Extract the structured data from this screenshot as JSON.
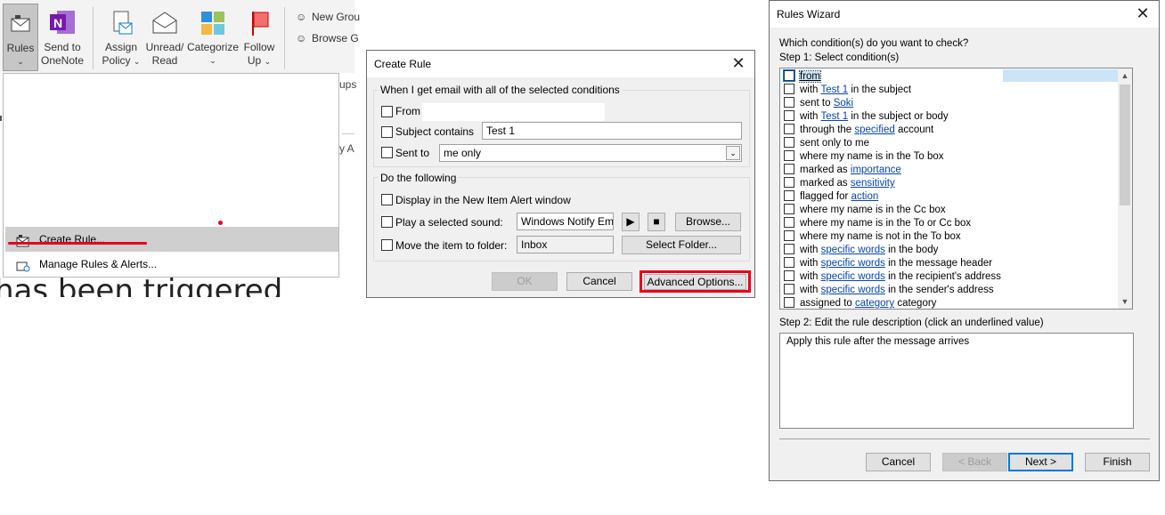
{
  "ribbon": {
    "rules_label": "Rules",
    "send_onenote_line1": "Send to",
    "send_onenote_line2": "OneNote",
    "assign_line1": "Assign",
    "assign_line2": "Policy",
    "unread_line1": "Unread/",
    "unread_line2": "Read",
    "categorize_label": "Categorize",
    "follow_line1": "Follow",
    "follow_line2": "Up",
    "new_group": "New Grou",
    "browse_groups": "Browse G",
    "frag_ups": "ups",
    "frag_a": "y A"
  },
  "rules_menu": {
    "create_rule": "Create Rule...",
    "manage_rules": "Manage Rules & Alerts..."
  },
  "background_text": "has been triggered",
  "create_rule": {
    "title": "Create Rule",
    "group1_label": "When I get email with all of the selected conditions",
    "from_label": "From",
    "from_value": "",
    "subject_label": "Subject contains",
    "subject_value": "Test 1",
    "sentto_label": "Sent to",
    "sentto_value": "me only",
    "group2_label": "Do the following",
    "display_alert": "Display in the New Item Alert window",
    "play_sound": "Play a selected sound:",
    "sound_value": "Windows Notify Em",
    "browse_btn": "Browse...",
    "move_item": "Move the item to folder:",
    "folder_value": "Inbox",
    "select_folder_btn": "Select Folder...",
    "ok_btn": "OK",
    "cancel_btn": "Cancel",
    "advanced_btn": "Advanced Options..."
  },
  "wizard": {
    "title": "Rules Wizard",
    "question": "Which condition(s) do you want to check?",
    "step1": "Step 1: Select condition(s)",
    "conditions": [
      {
        "pre": "",
        "link": "from",
        "post": ""
      },
      {
        "pre": "with ",
        "link": "Test 1",
        "post": " in the subject"
      },
      {
        "pre": "sent to ",
        "link": "Soki",
        "post": ""
      },
      {
        "pre": "with ",
        "link": "Test 1",
        "post": " in the subject or body"
      },
      {
        "pre": "through the ",
        "link": "specified",
        "post": " account"
      },
      {
        "pre": "sent only to me",
        "link": "",
        "post": ""
      },
      {
        "pre": "where my name is in the To box",
        "link": "",
        "post": ""
      },
      {
        "pre": "marked as ",
        "link": "importance",
        "post": ""
      },
      {
        "pre": "marked as ",
        "link": "sensitivity",
        "post": ""
      },
      {
        "pre": "flagged for ",
        "link": "action",
        "post": ""
      },
      {
        "pre": "where my name is in the Cc box",
        "link": "",
        "post": ""
      },
      {
        "pre": "where my name is in the To or Cc box",
        "link": "",
        "post": ""
      },
      {
        "pre": "where my name is not in the To box",
        "link": "",
        "post": ""
      },
      {
        "pre": "with ",
        "link": "specific words",
        "post": " in the body"
      },
      {
        "pre": "with ",
        "link": "specific words",
        "post": " in the message header"
      },
      {
        "pre": "with ",
        "link": "specific words",
        "post": " in the recipient's address"
      },
      {
        "pre": "with ",
        "link": "specific words",
        "post": " in the sender's address"
      },
      {
        "pre": "assigned to ",
        "link": "category",
        "post": " category"
      }
    ],
    "step2": "Step 2: Edit the rule description (click an underlined value)",
    "description": "Apply this rule after the message arrives",
    "cancel_btn": "Cancel",
    "back_btn": "< Back",
    "next_btn": "Next >",
    "finish_btn": "Finish"
  },
  "colors": {
    "highlight_red": "#e8001c",
    "link_blue": "#0645ad",
    "selection_blue": "#0078d7",
    "onenote_purple": "#7719aa"
  }
}
